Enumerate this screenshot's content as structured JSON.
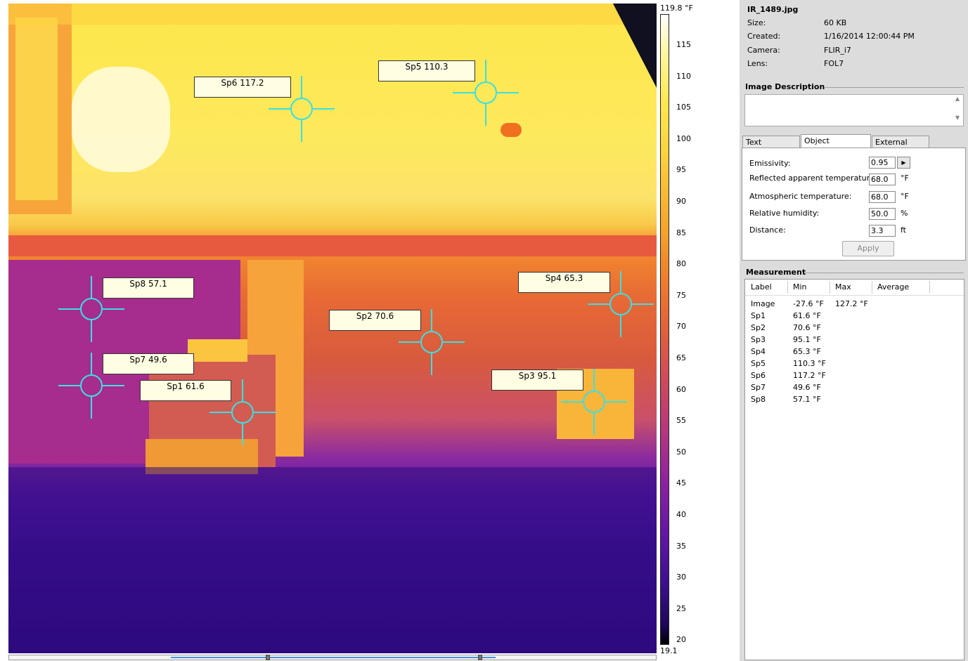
{
  "image": {
    "spots": [
      {
        "label": "Sp6 117.2"
      },
      {
        "label": "Sp5 110.3"
      },
      {
        "label": "Sp8 57.1"
      },
      {
        "label": "Sp4 65.3"
      },
      {
        "label": "Sp2 70.6"
      },
      {
        "label": "Sp7 49.6"
      },
      {
        "label": "Sp1 61.6"
      },
      {
        "label": "Sp3 95.1"
      }
    ],
    "crosshair_color": "#39e0e6"
  },
  "scale": {
    "max_label": "119.8 °F",
    "min_label": "19.1",
    "ticks": [
      "115",
      "110",
      "105",
      "100",
      "95",
      "90",
      "85",
      "80",
      "75",
      "70",
      "65",
      "60",
      "55",
      "50",
      "45",
      "40",
      "35",
      "30",
      "25",
      "20"
    ]
  },
  "file_info": {
    "filename": "IR_1489.jpg",
    "rows": [
      {
        "label": "Size:",
        "value": "60 KB"
      },
      {
        "label": "Created:",
        "value": "1/16/2014 12:00:44 PM"
      },
      {
        "label": "Camera:",
        "value": "FLIR_i7"
      },
      {
        "label": "Lens:",
        "value": "FOL7"
      }
    ]
  },
  "image_description": {
    "title": "Image Description",
    "scroll_up": "▲",
    "scroll_down": "▼"
  },
  "tabs": [
    {
      "label": "Text comments"
    },
    {
      "label": "Object parameters"
    },
    {
      "label": "External Sensor"
    }
  ],
  "object_parameters": {
    "emissivity": {
      "label": "Emissivity:",
      "value": "0.95",
      "button": "▶"
    },
    "reflected": {
      "label": "Reflected apparent temperature:",
      "value": "68.0",
      "unit": "°F"
    },
    "atmospheric": {
      "label": "Atmospheric temperature:",
      "value": "68.0",
      "unit": "°F"
    },
    "humidity": {
      "label": "Relative humidity:",
      "value": "50.0",
      "unit": "%"
    },
    "distance": {
      "label": "Distance:",
      "value": "3.3",
      "unit": "ft"
    },
    "apply_label": "Apply"
  },
  "measurement": {
    "title": "Measurement",
    "columns": [
      "Label",
      "Min",
      "Max",
      "Average"
    ],
    "rows": [
      {
        "label": "Image",
        "min": "-27.6 °F",
        "max": "127.2 °F"
      },
      {
        "label": "Sp1",
        "min": "61.6 °F",
        "max": ""
      },
      {
        "label": "Sp2",
        "min": "70.6 °F",
        "max": ""
      },
      {
        "label": "Sp3",
        "min": "95.1 °F",
        "max": ""
      },
      {
        "label": "Sp4",
        "min": "65.3 °F",
        "max": ""
      },
      {
        "label": "Sp5",
        "min": "110.3 °F",
        "max": ""
      },
      {
        "label": "Sp6",
        "min": "117.2 °F",
        "max": ""
      },
      {
        "label": "Sp7",
        "min": "49.6 °F",
        "max": ""
      },
      {
        "label": "Sp8",
        "min": "57.1 °F",
        "max": ""
      }
    ]
  }
}
